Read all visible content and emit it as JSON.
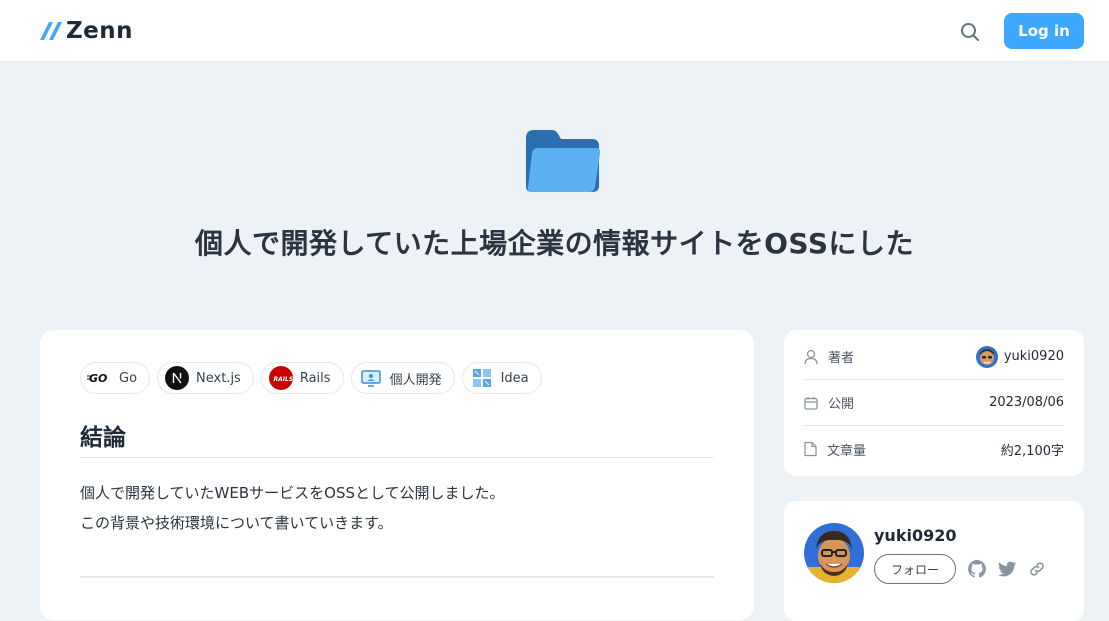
{
  "header": {
    "logo_text": "Zenn",
    "login_label": "Log in",
    "accent_color": "#3ea8ff"
  },
  "article": {
    "emoji": "folder-icon",
    "title": "個人で開発していた上場企業の情報サイトをOSSにした",
    "topics": [
      {
        "label": "Go",
        "icon": "go-logo-icon"
      },
      {
        "label": "Next.js",
        "icon": "nextjs-logo-icon"
      },
      {
        "label": "Rails",
        "icon": "rails-logo-icon"
      },
      {
        "label": "個人開発",
        "icon": "monitor-icon"
      },
      {
        "label": "Idea",
        "icon": "grid-icon"
      }
    ],
    "heading": "結論",
    "paragraph_lines": [
      "個人で開発していたWEBサービスをOSSとして公開しました。",
      "この背景や技術環境について書いていきます。"
    ]
  },
  "info": {
    "author_label": "著者",
    "author_value": "yuki0920",
    "published_label": "公開",
    "published_value": "2023/08/06",
    "length_label": "文章量",
    "length_value": "約2,100字"
  },
  "author_card": {
    "name": "yuki0920",
    "follow_label": "フォロー"
  }
}
